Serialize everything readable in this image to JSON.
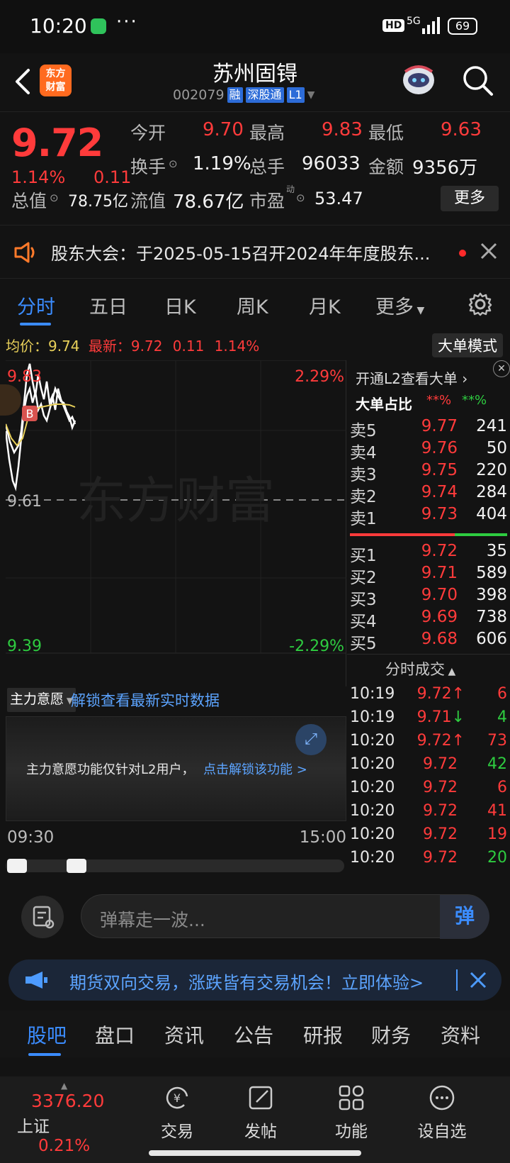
{
  "status": {
    "time": "10:20",
    "dots": "···",
    "hd": "HD",
    "signal": "5G",
    "battery": "69"
  },
  "header": {
    "logo_line1": "东方",
    "logo_line2": "财富",
    "name": "苏州固锝",
    "code": "002079",
    "tag_rong": "融",
    "tag_sgt": "深股通",
    "tag_l1": "L1"
  },
  "quote": {
    "price": "9.72",
    "change_pct": "1.14%",
    "change_abs": "0.11",
    "open_label": "今开",
    "open": "9.70",
    "high_label": "最高",
    "high": "9.83",
    "low_label": "最低",
    "low": "9.63",
    "turnover_label": "换手",
    "turnover": "1.19%",
    "volume_label": "总手",
    "volume": "96033",
    "amount_label": "金额",
    "amount": "9356万",
    "mktcap_label": "总值",
    "mktcap": "78.75亿",
    "float_label": "流值",
    "float": "78.67亿",
    "pe_label": "市盈",
    "pe_sup": "动",
    "pe": "53.47",
    "more": "更多"
  },
  "notice": {
    "text": "股东大会：于2025-05-15召开2024年年度股东..."
  },
  "tabs": [
    "分时",
    "五日",
    "日K",
    "周K",
    "月K",
    "更多"
  ],
  "avg_row": {
    "avg_label": "均价：",
    "avg": "9.74",
    "latest_label": "最新：",
    "latest": "9.72",
    "chg": "0.11",
    "pct": "1.14%",
    "big_order": "大单模式"
  },
  "chart": {
    "y_top": "9.83",
    "y_mid": "9.61",
    "y_bot": "9.39",
    "pct_top": "2.29%",
    "pct_bot": "-2.29%",
    "watermark": "东方财富",
    "b_marker": "B",
    "mode_label": "主力意愿",
    "unlock_link": "解锁查看最新实时数据",
    "l2_note": "主力意愿功能仅针对L2用户，",
    "l2_link": "点击解锁该功能 >",
    "time_start": "09:30",
    "time_end": "15:00"
  },
  "orderbook": {
    "l2_link": "开通L2查看大单",
    "ratio_label": "大单占比",
    "ratio_red": "**%",
    "ratio_green": "**%",
    "asks": [
      {
        "label": "卖5",
        "price": "9.77",
        "vol": "241"
      },
      {
        "label": "卖4",
        "price": "9.76",
        "vol": "50"
      },
      {
        "label": "卖3",
        "price": "9.75",
        "vol": "220"
      },
      {
        "label": "卖2",
        "price": "9.74",
        "vol": "284"
      },
      {
        "label": "卖1",
        "price": "9.73",
        "vol": "404"
      }
    ],
    "bids": [
      {
        "label": "买1",
        "price": "9.72",
        "vol": "35"
      },
      {
        "label": "买2",
        "price": "9.71",
        "vol": "589"
      },
      {
        "label": "买3",
        "price": "9.70",
        "vol": "398"
      },
      {
        "label": "买4",
        "price": "9.69",
        "vol": "738"
      },
      {
        "label": "买5",
        "price": "9.68",
        "vol": "606"
      }
    ],
    "trades_title": "分时成交",
    "trades": [
      {
        "time": "10:19",
        "price": "9.72",
        "arrow": "↑",
        "vol": "6"
      },
      {
        "time": "10:19",
        "price": "9.71",
        "arrow": "↓",
        "vol": "4"
      },
      {
        "time": "10:20",
        "price": "9.72",
        "arrow": "↑",
        "vol": "73"
      },
      {
        "time": "10:20",
        "price": "9.72",
        "arrow": "",
        "vol": "42"
      },
      {
        "time": "10:20",
        "price": "9.72",
        "arrow": "",
        "vol": "6"
      },
      {
        "time": "10:20",
        "price": "9.72",
        "arrow": "",
        "vol": "41"
      },
      {
        "time": "10:20",
        "price": "9.72",
        "arrow": "",
        "vol": "19"
      },
      {
        "time": "10:20",
        "price": "9.72",
        "arrow": "",
        "vol": "20"
      }
    ]
  },
  "comment": {
    "placeholder": "弹幕走一波...",
    "send": "弹"
  },
  "promo": {
    "text": "期货双向交易，涨跌皆有交易机会！立即体验>"
  },
  "bottom_tabs": [
    "股吧",
    "盘口",
    "资讯",
    "公告",
    "研报",
    "财务",
    "资料"
  ],
  "nav": {
    "index_value": "3376.20",
    "index_name": "上证",
    "index_pct": "0.21%",
    "items": [
      "交易",
      "发帖",
      "功能",
      "设自选"
    ]
  },
  "colors": {
    "up": "#ff3b3b",
    "down": "#2ecc40",
    "accent": "#3b8cff",
    "brand": "#ff6a1f"
  }
}
